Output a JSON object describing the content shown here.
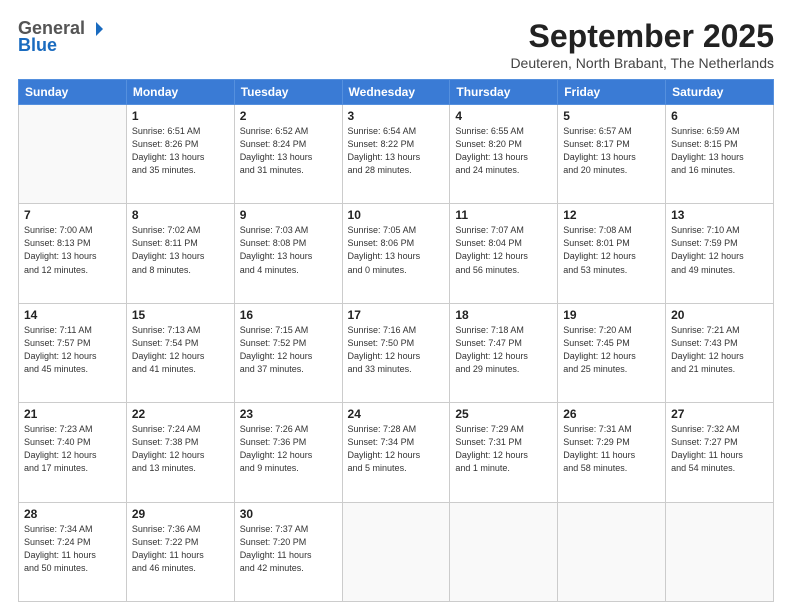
{
  "header": {
    "logo_line1": "General",
    "logo_line2": "Blue",
    "month_title": "September 2025",
    "subtitle": "Deuteren, North Brabant, The Netherlands"
  },
  "weekdays": [
    "Sunday",
    "Monday",
    "Tuesday",
    "Wednesday",
    "Thursday",
    "Friday",
    "Saturday"
  ],
  "weeks": [
    [
      {
        "day": "",
        "info": ""
      },
      {
        "day": "1",
        "info": "Sunrise: 6:51 AM\nSunset: 8:26 PM\nDaylight: 13 hours\nand 35 minutes."
      },
      {
        "day": "2",
        "info": "Sunrise: 6:52 AM\nSunset: 8:24 PM\nDaylight: 13 hours\nand 31 minutes."
      },
      {
        "day": "3",
        "info": "Sunrise: 6:54 AM\nSunset: 8:22 PM\nDaylight: 13 hours\nand 28 minutes."
      },
      {
        "day": "4",
        "info": "Sunrise: 6:55 AM\nSunset: 8:20 PM\nDaylight: 13 hours\nand 24 minutes."
      },
      {
        "day": "5",
        "info": "Sunrise: 6:57 AM\nSunset: 8:17 PM\nDaylight: 13 hours\nand 20 minutes."
      },
      {
        "day": "6",
        "info": "Sunrise: 6:59 AM\nSunset: 8:15 PM\nDaylight: 13 hours\nand 16 minutes."
      }
    ],
    [
      {
        "day": "7",
        "info": "Sunrise: 7:00 AM\nSunset: 8:13 PM\nDaylight: 13 hours\nand 12 minutes."
      },
      {
        "day": "8",
        "info": "Sunrise: 7:02 AM\nSunset: 8:11 PM\nDaylight: 13 hours\nand 8 minutes."
      },
      {
        "day": "9",
        "info": "Sunrise: 7:03 AM\nSunset: 8:08 PM\nDaylight: 13 hours\nand 4 minutes."
      },
      {
        "day": "10",
        "info": "Sunrise: 7:05 AM\nSunset: 8:06 PM\nDaylight: 13 hours\nand 0 minutes."
      },
      {
        "day": "11",
        "info": "Sunrise: 7:07 AM\nSunset: 8:04 PM\nDaylight: 12 hours\nand 56 minutes."
      },
      {
        "day": "12",
        "info": "Sunrise: 7:08 AM\nSunset: 8:01 PM\nDaylight: 12 hours\nand 53 minutes."
      },
      {
        "day": "13",
        "info": "Sunrise: 7:10 AM\nSunset: 7:59 PM\nDaylight: 12 hours\nand 49 minutes."
      }
    ],
    [
      {
        "day": "14",
        "info": "Sunrise: 7:11 AM\nSunset: 7:57 PM\nDaylight: 12 hours\nand 45 minutes."
      },
      {
        "day": "15",
        "info": "Sunrise: 7:13 AM\nSunset: 7:54 PM\nDaylight: 12 hours\nand 41 minutes."
      },
      {
        "day": "16",
        "info": "Sunrise: 7:15 AM\nSunset: 7:52 PM\nDaylight: 12 hours\nand 37 minutes."
      },
      {
        "day": "17",
        "info": "Sunrise: 7:16 AM\nSunset: 7:50 PM\nDaylight: 12 hours\nand 33 minutes."
      },
      {
        "day": "18",
        "info": "Sunrise: 7:18 AM\nSunset: 7:47 PM\nDaylight: 12 hours\nand 29 minutes."
      },
      {
        "day": "19",
        "info": "Sunrise: 7:20 AM\nSunset: 7:45 PM\nDaylight: 12 hours\nand 25 minutes."
      },
      {
        "day": "20",
        "info": "Sunrise: 7:21 AM\nSunset: 7:43 PM\nDaylight: 12 hours\nand 21 minutes."
      }
    ],
    [
      {
        "day": "21",
        "info": "Sunrise: 7:23 AM\nSunset: 7:40 PM\nDaylight: 12 hours\nand 17 minutes."
      },
      {
        "day": "22",
        "info": "Sunrise: 7:24 AM\nSunset: 7:38 PM\nDaylight: 12 hours\nand 13 minutes."
      },
      {
        "day": "23",
        "info": "Sunrise: 7:26 AM\nSunset: 7:36 PM\nDaylight: 12 hours\nand 9 minutes."
      },
      {
        "day": "24",
        "info": "Sunrise: 7:28 AM\nSunset: 7:34 PM\nDaylight: 12 hours\nand 5 minutes."
      },
      {
        "day": "25",
        "info": "Sunrise: 7:29 AM\nSunset: 7:31 PM\nDaylight: 12 hours\nand 1 minute."
      },
      {
        "day": "26",
        "info": "Sunrise: 7:31 AM\nSunset: 7:29 PM\nDaylight: 11 hours\nand 58 minutes."
      },
      {
        "day": "27",
        "info": "Sunrise: 7:32 AM\nSunset: 7:27 PM\nDaylight: 11 hours\nand 54 minutes."
      }
    ],
    [
      {
        "day": "28",
        "info": "Sunrise: 7:34 AM\nSunset: 7:24 PM\nDaylight: 11 hours\nand 50 minutes."
      },
      {
        "day": "29",
        "info": "Sunrise: 7:36 AM\nSunset: 7:22 PM\nDaylight: 11 hours\nand 46 minutes."
      },
      {
        "day": "30",
        "info": "Sunrise: 7:37 AM\nSunset: 7:20 PM\nDaylight: 11 hours\nand 42 minutes."
      },
      {
        "day": "",
        "info": ""
      },
      {
        "day": "",
        "info": ""
      },
      {
        "day": "",
        "info": ""
      },
      {
        "day": "",
        "info": ""
      }
    ]
  ]
}
